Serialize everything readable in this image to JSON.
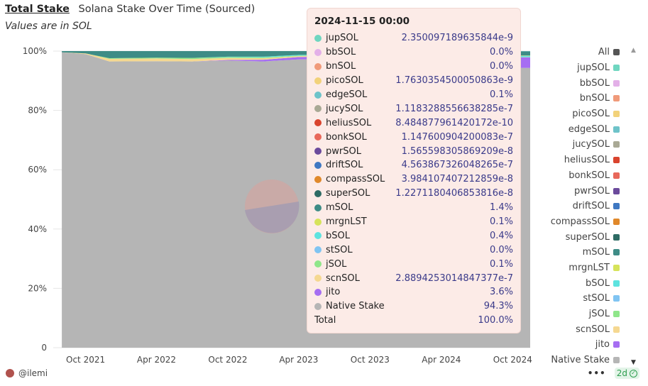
{
  "header": {
    "tab_label": "Total Stake",
    "title": "Solana Stake Over Time (Sourced)",
    "subtitle": "Values are in SOL"
  },
  "chart_data": {
    "type": "area",
    "stacked": true,
    "normalized": true,
    "y_tick_labels": [
      "100%",
      "80%",
      "60%",
      "40%",
      "20%",
      "0"
    ],
    "ylim": [
      0,
      100
    ],
    "x_tick_labels": [
      "Oct 2021",
      "Apr 2022",
      "Oct 2022",
      "Apr 2023",
      "Oct 2023",
      "Apr 2024",
      "Oct 2024"
    ],
    "x": [
      "2021-08-01",
      "2021-10-01",
      "2021-12-01",
      "2022-04-01",
      "2022-07-01",
      "2022-10-01",
      "2023-01-01",
      "2023-04-01",
      "2023-07-01",
      "2023-10-01",
      "2024-01-01",
      "2024-04-01",
      "2024-07-01",
      "2024-10-01",
      "2024-11-15"
    ],
    "series": [
      {
        "name": "Native Stake",
        "color": "#b5b5b5",
        "values": [
          99.6,
          99.0,
          96.5,
          96.6,
          96.5,
          96.8,
          96.5,
          97.2,
          97.2,
          96.8,
          96.0,
          95.2,
          94.8,
          94.4,
          94.3
        ]
      },
      {
        "name": "jito",
        "color": "#a66ef2",
        "values": [
          0,
          0,
          0,
          0,
          0,
          0.2,
          0.6,
          0.8,
          1.0,
          1.4,
          2.2,
          2.8,
          3.2,
          3.5,
          3.6
        ]
      },
      {
        "name": "scnSOL",
        "color": "#f5d891",
        "values": [
          0,
          0.2,
          0.9,
          0.9,
          0.8,
          0.7,
          0.5,
          0.3,
          0.2,
          0.1,
          0.1,
          0,
          0,
          0,
          0
        ]
      },
      {
        "name": "jSOL",
        "color": "#8fe68a",
        "values": [
          0,
          0,
          0.2,
          0.3,
          0.4,
          0.3,
          0.3,
          0.2,
          0.2,
          0.1,
          0.1,
          0.1,
          0.1,
          0.1,
          0.1
        ]
      },
      {
        "name": "bSOL",
        "color": "#5de3df",
        "values": [
          0,
          0,
          0,
          0,
          0,
          0.1,
          0.2,
          0.2,
          0.2,
          0.3,
          0.4,
          0.4,
          0.4,
          0.4,
          0.4
        ]
      },
      {
        "name": "mrgnLST",
        "color": "#d6e35a",
        "values": [
          0,
          0,
          0,
          0,
          0,
          0,
          0,
          0,
          0,
          0,
          0.1,
          0.1,
          0.1,
          0.1,
          0.1
        ]
      },
      {
        "name": "mSOL",
        "color": "#3e8c86",
        "values": [
          0.4,
          0.8,
          2.4,
          2.2,
          2.3,
          1.9,
          1.9,
          1.3,
          1.2,
          1.3,
          1.1,
          1.3,
          1.3,
          1.4,
          1.4
        ]
      },
      {
        "name": "edgeSOL",
        "color": "#6ec3c9",
        "values": [
          0,
          0,
          0,
          0,
          0,
          0,
          0,
          0,
          0,
          0,
          0,
          0.1,
          0.1,
          0.1,
          0.1
        ]
      }
    ],
    "hover_date_label": "2024-11-15 00:00"
  },
  "legend": {
    "items": [
      {
        "label": "All",
        "color": "#555555"
      },
      {
        "label": "jupSOL",
        "color": "#6fd6c0"
      },
      {
        "label": "bbSOL",
        "color": "#e3b0e8"
      },
      {
        "label": "bnSOL",
        "color": "#f09a7a"
      },
      {
        "label": "picoSOL",
        "color": "#f2d27a"
      },
      {
        "label": "edgeSOL",
        "color": "#6ec3c9"
      },
      {
        "label": "jucySOL",
        "color": "#a9a995"
      },
      {
        "label": "heliusSOL",
        "color": "#d9442e"
      },
      {
        "label": "bonkSOL",
        "color": "#e8685a"
      },
      {
        "label": "pwrSOL",
        "color": "#6b4a9c"
      },
      {
        "label": "driftSOL",
        "color": "#3f78c2"
      },
      {
        "label": "compassSOL",
        "color": "#e0882a"
      },
      {
        "label": "superSOL",
        "color": "#2e6b64"
      },
      {
        "label": "mSOL",
        "color": "#3e8c86"
      },
      {
        "label": "mrgnLST",
        "color": "#d6e35a"
      },
      {
        "label": "bSOL",
        "color": "#5de3df"
      },
      {
        "label": "stSOL",
        "color": "#80c4f2"
      },
      {
        "label": "jSOL",
        "color": "#8fe68a"
      },
      {
        "label": "scnSOL",
        "color": "#f5d891"
      },
      {
        "label": "jito",
        "color": "#a66ef2"
      },
      {
        "label": "Native Stake",
        "color": "#b5b5b5"
      }
    ],
    "scroll_down_glyph": "▼",
    "scroll_up_glyph": "▲"
  },
  "tooltip": {
    "title": "2024-11-15 00:00",
    "rows": [
      {
        "name": "jupSOL",
        "value": "2.350097189635844e-9",
        "color": "#6fd6c0"
      },
      {
        "name": "bbSOL",
        "value": "0.0%",
        "color": "#e3b0e8"
      },
      {
        "name": "bnSOL",
        "value": "0.0%",
        "color": "#f09a7a"
      },
      {
        "name": "picoSOL",
        "value": "1.7630354500050863e-9",
        "color": "#f2d27a"
      },
      {
        "name": "edgeSOL",
        "value": "0.1%",
        "color": "#6ec3c9"
      },
      {
        "name": "jucySOL",
        "value": "1.1183288556638285e-7",
        "color": "#a9a995"
      },
      {
        "name": "heliusSOL",
        "value": "8.484877961420172e-10",
        "color": "#d9442e"
      },
      {
        "name": "bonkSOL",
        "value": "1.147600904200083e-7",
        "color": "#e8685a"
      },
      {
        "name": "pwrSOL",
        "value": "1.565598305869209e-8",
        "color": "#6b4a9c"
      },
      {
        "name": "driftSOL",
        "value": "4.563867326048265e-7",
        "color": "#3f78c2"
      },
      {
        "name": "compassSOL",
        "value": "3.984107407212859e-8",
        "color": "#e0882a"
      },
      {
        "name": "superSOL",
        "value": "1.2271180406853816e-8",
        "color": "#2e6b64"
      },
      {
        "name": "mSOL",
        "value": "1.4%",
        "color": "#3e8c86"
      },
      {
        "name": "mrgnLST",
        "value": "0.1%",
        "color": "#d6e35a"
      },
      {
        "name": "bSOL",
        "value": "0.4%",
        "color": "#5de3df"
      },
      {
        "name": "stSOL",
        "value": "0.0%",
        "color": "#80c4f2"
      },
      {
        "name": "jSOL",
        "value": "0.1%",
        "color": "#8fe68a"
      },
      {
        "name": "scnSOL",
        "value": "2.8894253014847377e-7",
        "color": "#f5d891"
      },
      {
        "name": "jito",
        "value": "3.6%",
        "color": "#a66ef2"
      },
      {
        "name": "Native Stake",
        "value": "94.3%",
        "color": "#b5b5b5"
      }
    ],
    "total_label": "Total",
    "total_value": "100.0%"
  },
  "footer": {
    "author": "@ilemi",
    "more_glyph": "•••",
    "age": "2d",
    "check_glyph": "✓"
  }
}
